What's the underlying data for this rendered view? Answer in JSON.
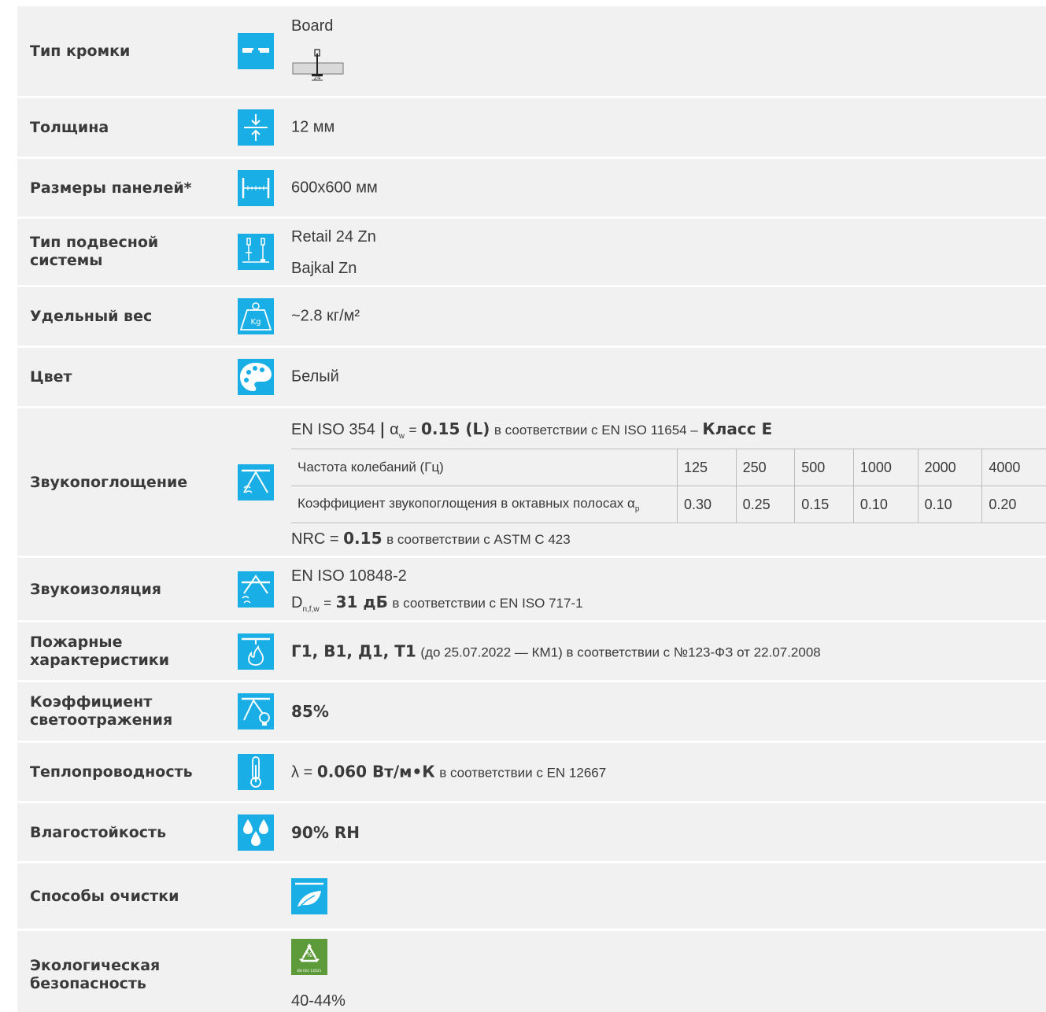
{
  "colors": {
    "row_bg": "#f1f1f1",
    "icon_blue": "#19aee5",
    "eco_green": "#5c9a3a",
    "text": "#3a3a3a"
  },
  "rows": {
    "edge": {
      "label": "Тип кромки",
      "value": "Board",
      "dim": "24",
      "icon": "edge-type-icon"
    },
    "thickness": {
      "label": "Толщина",
      "value": "12 мм",
      "icon": "thickness-icon"
    },
    "size": {
      "label": "Размеры панелей*",
      "value": "600x600 мм",
      "icon": "panel-size-icon"
    },
    "suspension": {
      "label": "Тип подвесной\nсистемы",
      "value1": "Retail 24 Zn",
      "value2": "Bajkal Zn",
      "icon": "suspension-system-icon"
    },
    "weight": {
      "label": "Удельный вес",
      "value": "~2.8 кг/м²",
      "icon": "weight-icon",
      "icon_text": "Kg"
    },
    "color": {
      "label": "Цвет",
      "value": "Белый",
      "icon": "palette-icon"
    },
    "absorption": {
      "label": "Звукопоглощение",
      "icon": "sound-absorption-icon",
      "std": "EN ISO 354",
      "sep": "|",
      "alpha": "α",
      "alpha_sub": "w",
      "eq": "=",
      "alpha_value": "0.15 (L)",
      "according": "в соответствии с EN ISO 11654 –",
      "class": "Класс E",
      "freq_header": "Частота колебаний (Гц)",
      "coef_header": "Коэффициент звукопоглощения в октавных полосах α",
      "coef_sub": "p",
      "frequencies": [
        "125",
        "250",
        "500",
        "1000",
        "2000",
        "4000"
      ],
      "coefficients": [
        "0.30",
        "0.25",
        "0.15",
        "0.10",
        "0.10",
        "0.20"
      ],
      "nrc_label": "NRC =",
      "nrc_value": "0.15",
      "nrc_std": "в соответствии с ASTM C 423"
    },
    "insulation": {
      "label": "Звукоизоляция",
      "icon": "sound-insulation-icon",
      "std": "EN ISO 10848-2",
      "d": "D",
      "d_sub": "n,f,w",
      "eq": "=",
      "value": "31 дБ",
      "according": "в соответствии с EN ISO 717-1"
    },
    "fire": {
      "label": "Пожарные\nхарактеристики",
      "icon": "fire-icon",
      "value": "Г1, В1, Д1, Т1",
      "rest": "(до 25.07.2022 — КМ1) в соответствии с №123-ФЗ от 22.07.2008"
    },
    "reflect": {
      "label": "Коэффициент\nсветоотражения",
      "value": "85%",
      "icon": "light-reflection-icon"
    },
    "thermal": {
      "label": "Теплопроводность",
      "icon": "thermometer-icon",
      "lambda": "λ =",
      "value": "0.060 Вт/м•К",
      "according": "в соответствии с EN 12667"
    },
    "humidity": {
      "label": "Влагостойкость",
      "value": "90% RH",
      "icon": "water-drops-icon"
    },
    "cleaning": {
      "label": "Способы очистки",
      "icon": "cleaning-icon"
    },
    "eco": {
      "label": "Экологическая\nбезопасность",
      "value": "40-44%",
      "icon": "recycle-icon",
      "icon_text": "EN ISO 14021"
    }
  }
}
